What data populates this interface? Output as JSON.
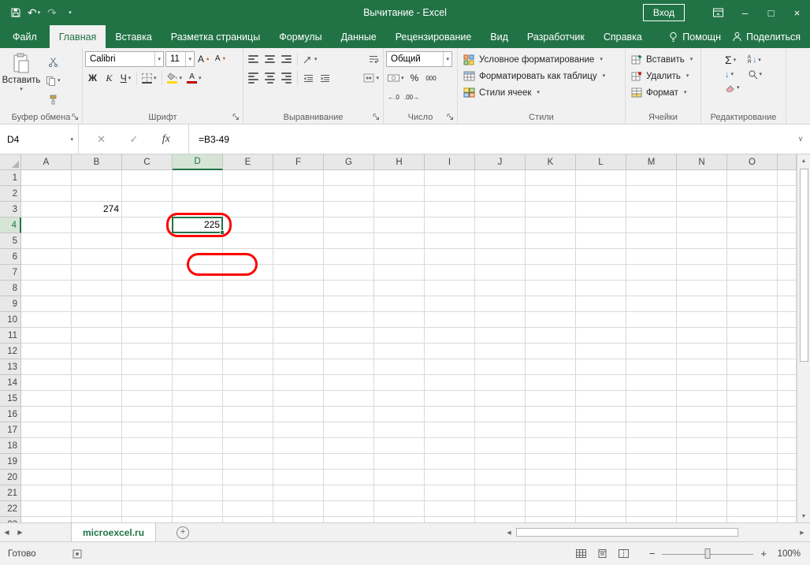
{
  "colors": {
    "excel_green": "#217346",
    "annotation_red": "#ff0000",
    "header_highlight": "#d6e4d6"
  },
  "titlebar": {
    "title": "Вычитание - Excel",
    "signin_label": "Вход"
  },
  "ribbon_tabs": {
    "file": "Файл",
    "tabs": [
      "Главная",
      "Вставка",
      "Разметка страницы",
      "Формулы",
      "Данные",
      "Рецензирование",
      "Вид",
      "Разработчик",
      "Справка"
    ],
    "active": "Главная",
    "helper": "Помощн",
    "share": "Поделиться"
  },
  "ribbon": {
    "clipboard": {
      "label": "Буфер обмена",
      "paste": "Вставить"
    },
    "font": {
      "label": "Шрифт",
      "family": "Calibri",
      "size": "11",
      "bold": "Ж",
      "italic": "К",
      "underline": "Ч"
    },
    "alignment": {
      "label": "Выравнивание"
    },
    "number": {
      "label": "Число",
      "format": "Общий"
    },
    "styles": {
      "label": "Стили",
      "conditional_formatting": "Условное форматирование",
      "format_as_table": "Форматировать как таблицу",
      "cell_styles": "Стили ячеек"
    },
    "cells": {
      "label": "Ячейки",
      "insert": "Вставить",
      "delete": "Удалить",
      "format": "Формат"
    },
    "editing": {
      "label": "Редактирование"
    }
  },
  "formula_bar": {
    "name_box": "D4",
    "formula": "=B3-49"
  },
  "grid": {
    "columns": [
      "A",
      "B",
      "C",
      "D",
      "E",
      "F",
      "G",
      "H",
      "I",
      "J",
      "K",
      "L",
      "M",
      "N",
      "O"
    ],
    "row_count": 22,
    "cells": {
      "B3": "274",
      "D4": "225"
    },
    "selection": {
      "cell": "D4",
      "column": "D",
      "row": 4
    }
  },
  "sheetbar": {
    "active_sheet": "microexcel.ru"
  },
  "statusbar": {
    "mode": "Готово",
    "zoom": "100%"
  },
  "icons": {
    "dropdown": "▾",
    "undo": "↶",
    "redo": "↷",
    "minimize": "–",
    "maximize": "□",
    "close": "×",
    "cancel_entry": "✕",
    "confirm_entry": "✓",
    "function": "fx",
    "font_letter": "А",
    "up_arrow": "▲",
    "down_arrow": "▼",
    "autosum": "Σ",
    "percent": "%",
    "thousands": "000",
    "increase_decimal": "←.0",
    "decrease_decimal": ".00→",
    "fill_down": "↓",
    "sort_a": "А",
    "sort_z": "Я",
    "sort_arrow": "↓",
    "nav_left": "◀",
    "nav_right": "▶",
    "scroll_up": "▲",
    "scroll_down": "▼",
    "scroll_left": "◀",
    "scroll_right": "▶",
    "add_sheet": "+",
    "zoom_out": "−",
    "zoom_in": "+",
    "expand_formula_bar": "∨"
  }
}
